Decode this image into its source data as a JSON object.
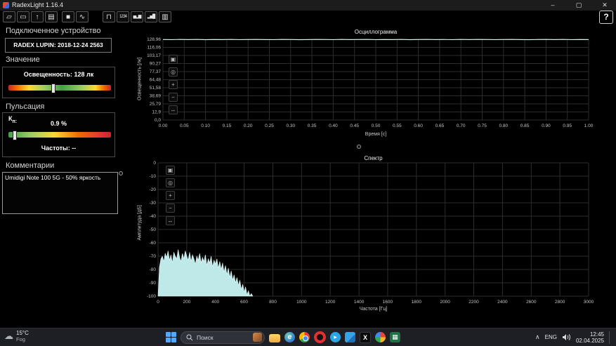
{
  "window": {
    "title": "RadexLight 1.16.4",
    "minimize": "–",
    "maximize": "▢",
    "close": "✕",
    "help_label": "?"
  },
  "toolbar": {
    "buttons": [
      {
        "name": "open-file",
        "glyph": "▱"
      },
      {
        "name": "save-file",
        "glyph": "▭"
      },
      {
        "name": "export",
        "glyph": "↑"
      },
      {
        "name": "device-settings",
        "glyph": "▤"
      },
      {
        "name": "display-mode",
        "glyph": "■"
      },
      {
        "name": "oscillogram-view",
        "glyph": "∿"
      },
      {
        "name": "pulse-view",
        "glyph": "⊓"
      },
      {
        "name": "timer-view",
        "glyph": "12:34"
      },
      {
        "name": "histogram-view",
        "glyph": "▅▂▆"
      },
      {
        "name": "spectrum-view",
        "glyph": "▂▅█"
      },
      {
        "name": "layout-view",
        "glyph": "▥"
      }
    ]
  },
  "left_panel": {
    "device_heading": "Подключенное устройство",
    "device_name": "RADEX LUPIN: 2018-12-24 2563",
    "value_heading": "Значение",
    "illuminance_label": "Освещенность: 128 лк",
    "lux_thumb_pos": 0.42,
    "pulsation_heading": "Пульсация",
    "kp_label_main": "К",
    "kp_label_sub": "п:",
    "kp_value": "0.9 %",
    "kp_thumb_pos": 0.04,
    "frequencies_label": "Частоты: --",
    "comments_heading": "Комментарии",
    "comment_text": "Umidigi Note 100 5G - 50% яркость"
  },
  "charts": {
    "tools": [
      {
        "name": "select-tool",
        "glyph": "▣"
      },
      {
        "name": "zoom-tool",
        "glyph": "◎"
      },
      {
        "name": "zoom-in-tool",
        "glyph": "+"
      },
      {
        "name": "zoom-out-tool",
        "glyph": "−"
      },
      {
        "name": "pan-tool",
        "glyph": "↔"
      }
    ]
  },
  "chart_data": [
    {
      "type": "line",
      "title": "Осциллограмма",
      "xlabel": "Время [с]",
      "ylabel": "Освещенность [лк]",
      "xlim": [
        0,
        1
      ],
      "ylim": [
        0,
        128.96
      ],
      "yticks": [
        [
          128.96,
          "128,96"
        ],
        [
          116.06,
          "116,06"
        ],
        [
          103.17,
          "103,17"
        ],
        [
          90.27,
          "90,27"
        ],
        [
          77.37,
          "77,37"
        ],
        [
          64.48,
          "64,48"
        ],
        [
          51.58,
          "51,58"
        ],
        [
          38.69,
          "38,69"
        ],
        [
          25.79,
          "25,79"
        ],
        [
          12.9,
          "12,9"
        ],
        [
          0,
          "0,0"
        ]
      ],
      "xticks": [
        [
          0,
          "0.00"
        ],
        [
          0.05,
          "0.05"
        ],
        [
          0.1,
          "0.10"
        ],
        [
          0.15,
          "0.15"
        ],
        [
          0.2,
          "0.20"
        ],
        [
          0.25,
          "0.25"
        ],
        [
          0.3,
          "0.30"
        ],
        [
          0.35,
          "0.35"
        ],
        [
          0.4,
          "0.40"
        ],
        [
          0.45,
          "0.45"
        ],
        [
          0.5,
          "0.50"
        ],
        [
          0.55,
          "0.55"
        ],
        [
          0.6,
          "0.60"
        ],
        [
          0.65,
          "0.65"
        ],
        [
          0.7,
          "0.70"
        ],
        [
          0.75,
          "0.75"
        ],
        [
          0.8,
          "0.80"
        ],
        [
          0.85,
          "0.85"
        ],
        [
          0.9,
          "0.90"
        ],
        [
          0.95,
          "0.95"
        ],
        [
          1,
          "1.00"
        ]
      ],
      "x_start": 0,
      "x_step": 0.02,
      "values": [
        128.6,
        128.4,
        128.7,
        128.5,
        128.8,
        128.3,
        128.6,
        128.5,
        128.7,
        128.4,
        128.6,
        128.8,
        128.5,
        128.4,
        128.7,
        128.6,
        128.3,
        128.5,
        128.8,
        128.6,
        128.4,
        128.7,
        128.5,
        128.6,
        128.8,
        128.4,
        128.6,
        128.5,
        128.7,
        128.3,
        128.6,
        128.8,
        128.5,
        128.6,
        128.4,
        128.7,
        128.5,
        128.8,
        128.6,
        128.4,
        128.6,
        128.7,
        128.5,
        128.3,
        128.6,
        128.8,
        128.5,
        128.7,
        128.4,
        128.6,
        128.5
      ]
    },
    {
      "type": "area",
      "title": "Спектр",
      "xlabel": "Частота [Гц]",
      "ylabel": "Амплитуда [дБ]",
      "xlim": [
        0,
        3000
      ],
      "ylim": [
        -100,
        0
      ],
      "yticks": [
        [
          0,
          "0"
        ],
        [
          -10,
          "-10"
        ],
        [
          -20,
          "-20"
        ],
        [
          -30,
          "-30"
        ],
        [
          -40,
          "-40"
        ],
        [
          -50,
          "-50"
        ],
        [
          -60,
          "-60"
        ],
        [
          -70,
          "-70"
        ],
        [
          -80,
          "-80"
        ],
        [
          -90,
          "-90"
        ],
        [
          -100,
          "-100"
        ]
      ],
      "xticks": [
        [
          0,
          "0"
        ],
        [
          200,
          "200"
        ],
        [
          400,
          "400"
        ],
        [
          600,
          "600"
        ],
        [
          800,
          "800"
        ],
        [
          1000,
          "1000"
        ],
        [
          1200,
          "1200"
        ],
        [
          1400,
          "1400"
        ],
        [
          1600,
          "1600"
        ],
        [
          1800,
          "1800"
        ],
        [
          2000,
          "2000"
        ],
        [
          2200,
          "2200"
        ],
        [
          2400,
          "2400"
        ],
        [
          2600,
          "2600"
        ],
        [
          2800,
          "2800"
        ],
        [
          3000,
          "3000"
        ]
      ],
      "x_start": 0,
      "x_step": 10,
      "values": [
        -100,
        -78,
        -72,
        -70,
        -74,
        -68,
        -71,
        -66,
        -73,
        -69,
        -75,
        -67,
        -70,
        -72,
        -65,
        -71,
        -74,
        -68,
        -72,
        -66,
        -70,
        -73,
        -67,
        -74,
        -69,
        -72,
        -76,
        -70,
        -73,
        -68,
        -75,
        -71,
        -74,
        -69,
        -77,
        -72,
        -75,
        -70,
        -78,
        -73,
        -76,
        -72,
        -79,
        -74,
        -80,
        -75,
        -82,
        -77,
        -84,
        -79,
        -86,
        -81,
        -88,
        -84,
        -90,
        -86,
        -92,
        -88,
        -95,
        -91,
        -97,
        -93,
        -99,
        -96,
        -100,
        -98,
        -100
      ]
    }
  ],
  "taskbar": {
    "weather_temp": "15°C",
    "weather_condition": "Fog",
    "search_placeholder": "Поиск",
    "apps": [
      {
        "name": "file-explorer"
      },
      {
        "name": "edge"
      },
      {
        "name": "chrome"
      },
      {
        "name": "opera"
      },
      {
        "name": "telegram"
      },
      {
        "name": "vscode"
      },
      {
        "name": "x"
      },
      {
        "name": "photos"
      },
      {
        "name": "excel"
      }
    ],
    "tray_chevron": "∧",
    "tray_lang": "ENG",
    "clock_time": "12:45",
    "clock_date": "02.04.2025"
  }
}
